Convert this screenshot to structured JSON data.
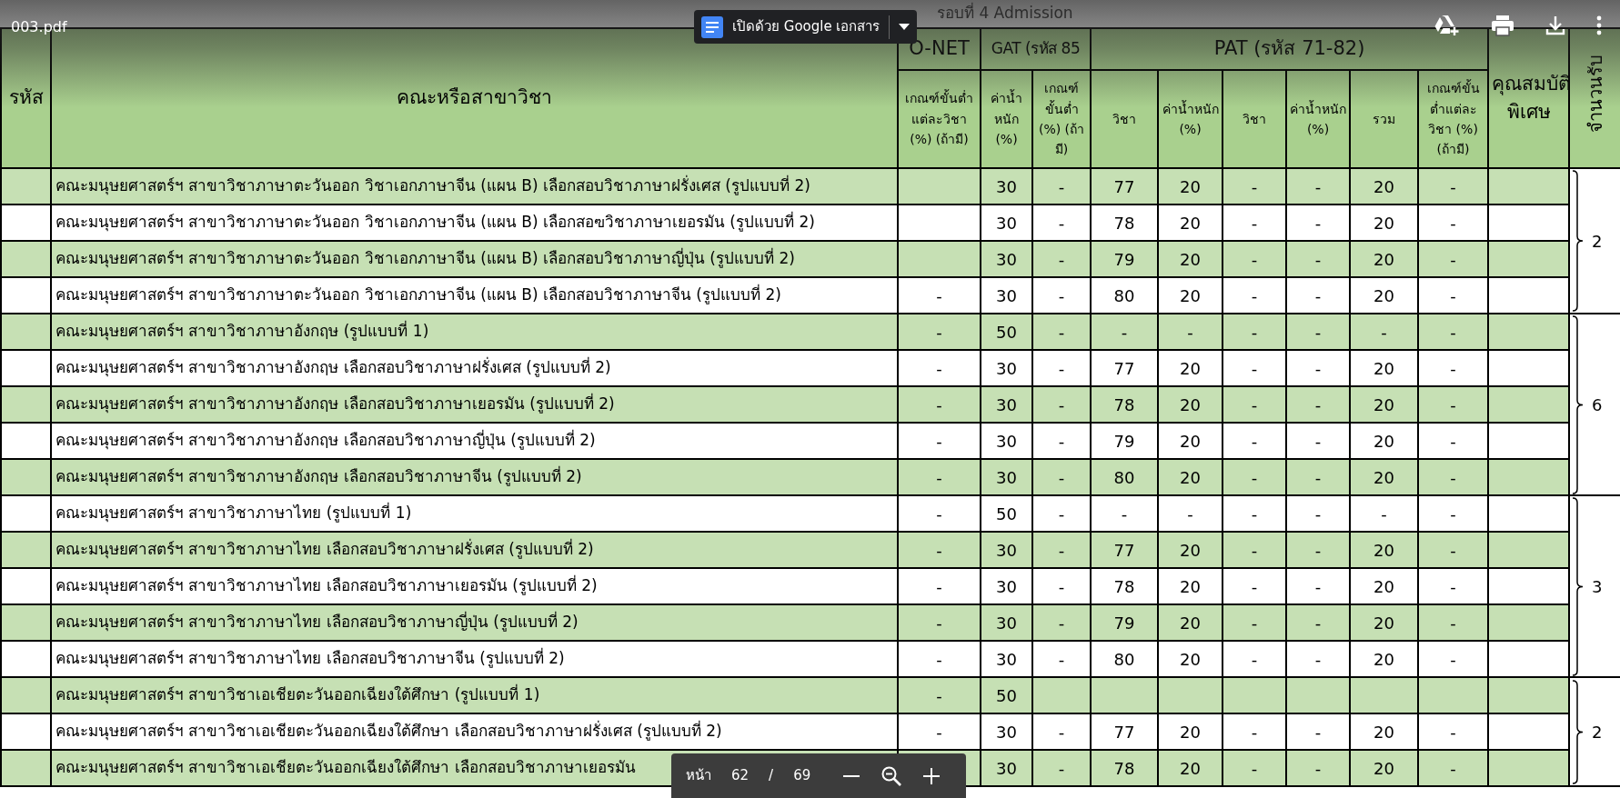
{
  "top_bar": {
    "file_name": "003.pdf",
    "open_with_button": "เปิดด้วย Google เอกสาร"
  },
  "document": {
    "title": "รอบที่ 4 Admission",
    "table": {
      "header_top": [
        "รหัส",
        "คณะหรือสาขาวิชา",
        "O-NET",
        "GAT (รหัส 85",
        "PAT (รหัส 71-82)",
        "คุณสมบัติพิเศษ",
        "จำนวนรับ"
      ],
      "sub_headers": [
        "เกณฑ์ขั้นต่ำแต่ละวิชา (%) (ถ้ามี)",
        "ค่าน้ำหนัก (%)",
        "เกณฑ์ขั้นต่ำ (%) (ถ้ามี)",
        "วิชา",
        "ค่าน้ำหนัก (%)",
        "วิชา",
        "ค่าน้ำหนัก (%)",
        "รวม",
        "เกณฑ์ขั้นต่ำแต่ละวิชา (%) (ถ้ามี)"
      ],
      "groups": [
        {
          "enrollment": "2",
          "rows": [
            {
              "cells": [
                "คณะมนุษยศาสตร์ฯ สาขาวิชาภาษาตะวันออก วิชาเอกภาษาจีน  (แผน B) เลือกสอบวิชาภาษาฝรั่งเศส (รูปแบบที่ 2)",
                null,
                "30",
                "-",
                "77",
                "20",
                "-",
                "-",
                "20",
                "-"
              ]
            },
            {
              "cells": [
                "คณะมนุษยศาสตร์ฯ สาขาวิชาภาษาตะวันออก วิชาเอกภาษาจีน  (แผน B) เลือกสอฃวิชาภาษาเยอรมัน (รูปแบบที่ 2)",
                null,
                "30",
                "-",
                "78",
                "20",
                "-",
                "-",
                "20",
                "-"
              ]
            },
            {
              "cells": [
                "คณะมนุษยศาสตร์ฯ สาขาวิชาภาษาตะวันออก วิชาเอกภาษาจีน  (แผน B) เลือกสอบวิชาภาษาญี่ปุ่น (รูปแบบที่ 2)",
                null,
                "30",
                "-",
                "79",
                "20",
                "-",
                "-",
                "20",
                "-"
              ]
            },
            {
              "cells": [
                "คณะมนุษยศาสตร์ฯ สาขาวิชาภาษาตะวันออก วิชาเอกภาษาจีน  (แผน B) เลือกสอบวิชาภาษาจีน (รูปแบบที่ 2)",
                "-",
                "30",
                "-",
                "80",
                "20",
                "-",
                "-",
                "20",
                "-"
              ]
            }
          ]
        },
        {
          "enrollment": "6",
          "rows": [
            {
              "cells": [
                "คณะมนุษยศาสตร์ฯ สาขาวิชาภาษาอังกฤษ (รูปแบบที่ 1)",
                "-",
                "50",
                "-",
                "-",
                "-",
                "-",
                "-",
                "-",
                "-"
              ]
            },
            {
              "cells": [
                "คณะมนุษยศาสตร์ฯ สาขาวิชาภาษาอังกฤษ เลือกสอบวิชาภาษาฝรั่งเศส (รูปแบบที่ 2)",
                "-",
                "30",
                "-",
                "77",
                "20",
                "-",
                "-",
                "20",
                "-"
              ]
            },
            {
              "cells": [
                "คณะมนุษยศาสตร์ฯ สาขาวิชาภาษาอังกฤษ เลือกสอบวิชาภาษาเยอรมัน (รูปแบบที่ 2)",
                "-",
                "30",
                "-",
                "78",
                "20",
                "-",
                "-",
                "20",
                "-"
              ]
            },
            {
              "cells": [
                "คณะมนุษยศาสตร์ฯ สาขาวิชาภาษาอังกฤษ เลือกสอบวิชาภาษาญี่ปุ่น (รูปแบบที่ 2)",
                "-",
                "30",
                "-",
                "79",
                "20",
                "-",
                "-",
                "20",
                "-"
              ]
            },
            {
              "cells": [
                "คณะมนุษยศาสตร์ฯ สาขาวิชาภาษาอังกฤษ เลือกสอบวิชาภาษาจีน (รูปแบบที่ 2)",
                "-",
                "30",
                "-",
                "80",
                "20",
                "-",
                "-",
                "20",
                "-"
              ]
            }
          ]
        },
        {
          "enrollment": "3",
          "rows": [
            {
              "cells": [
                "คณะมนุษยศาสตร์ฯ สาขาวิชาภาษาไทย (รูปแบบที่ 1)",
                "-",
                "50",
                "-",
                "-",
                "-",
                "-",
                "-",
                "-",
                "-"
              ]
            },
            {
              "cells": [
                "คณะมนุษยศาสตร์ฯ สาขาวิชาภาษาไทย เลือกสอบวิชาภาษาฝรั่งเศส (รูปแบบที่ 2)",
                "-",
                "30",
                "-",
                "77",
                "20",
                "-",
                "-",
                "20",
                "-"
              ]
            },
            {
              "cells": [
                "คณะมนุษยศาสตร์ฯ สาขาวิชาภาษาไทย เลือกสอบวิชาภาษาเยอรมัน (รูปแบบที่ 2)",
                "-",
                "30",
                "-",
                "78",
                "20",
                "-",
                "-",
                "20",
                "-"
              ]
            },
            {
              "cells": [
                "คณะมนุษยศาสตร์ฯ สาขาวิชาภาษาไทย เลือกสอบวิชาภาษาญี่ปุ่น (รูปแบบที่ 2)",
                "-",
                "30",
                "-",
                "79",
                "20",
                "-",
                "-",
                "20",
                "-"
              ]
            },
            {
              "cells": [
                "คณะมนุษยศาสตร์ฯ สาขาวิชาภาษาไทย เลือกสอบวิชาภาษาจีน (รูปแบบที่ 2)",
                "-",
                "30",
                "-",
                "80",
                "20",
                "-",
                "-",
                "20",
                "-"
              ]
            }
          ]
        },
        {
          "enrollment": "2",
          "rows": [
            {
              "cells": [
                "คณะมนุษยศาสตร์ฯ สาขาวิชาเอเชียตะวันออกเฉียงใต้ศึกษา (รูปแบบที่ 1)",
                "-",
                "50",
                null,
                null,
                null,
                null,
                null,
                null,
                null
              ]
            },
            {
              "cells": [
                "คณะมนุษยศาสตร์ฯ สาขาวิชาเอเชียตะวันออกเฉียงใต้ศึกษา เลือกสอบวิชาภาษาฝรั่งเศส (รูปแบบที่ 2)",
                "-",
                "30",
                "-",
                "77",
                "20",
                "-",
                "-",
                "20",
                "-"
              ]
            },
            {
              "cells": [
                "คณะมนุษยศาสตร์ฯ สาขาวิชาเอเชียตะวันออกเฉียงใต้ศึกษา เลือกสอบวิชาภาษาเยอรมัน",
                null,
                "30",
                "-",
                "78",
                "20",
                "-",
                "-",
                "20",
                "-"
              ]
            }
          ]
        }
      ]
    }
  },
  "page_toolbar": {
    "label": "หน้า",
    "current": "62",
    "separator": "/",
    "total": "69"
  }
}
